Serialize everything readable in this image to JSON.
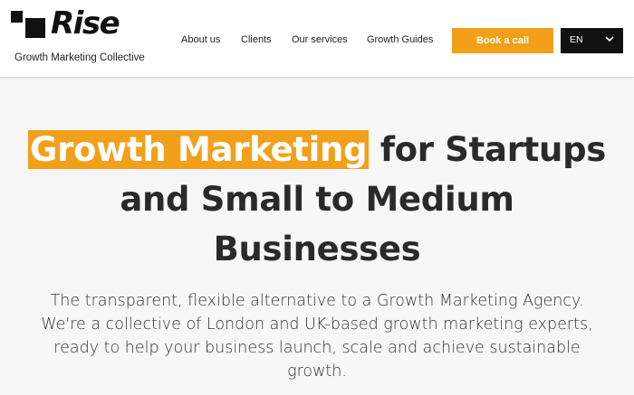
{
  "brand": {
    "name": "Rise",
    "tagline": "Growth Marketing Collective"
  },
  "nav": {
    "items": [
      {
        "label": "About us"
      },
      {
        "label": "Clients"
      },
      {
        "label": "Our services"
      },
      {
        "label": "Growth Guides"
      }
    ],
    "cta_label": "Book a call",
    "language": {
      "selected": "EN",
      "icon": "chevron-down-icon"
    }
  },
  "hero": {
    "title_highlight": "Growth Marketing",
    "title_rest_1": " for Startups",
    "title_rest_2": "and Small to Medium",
    "title_rest_3": "Businesses",
    "subtitle_1": "The transparent, flexible alternative to a Growth Marketing Agency.",
    "subtitle_2": "We're a collective of London and UK-based growth marketing experts,",
    "subtitle_3": "ready to help your business launch, scale and achieve sustainable",
    "subtitle_4": "growth."
  },
  "colors": {
    "accent": "#f2a01a",
    "dark": "#111111",
    "background": "#f7f7f7"
  }
}
